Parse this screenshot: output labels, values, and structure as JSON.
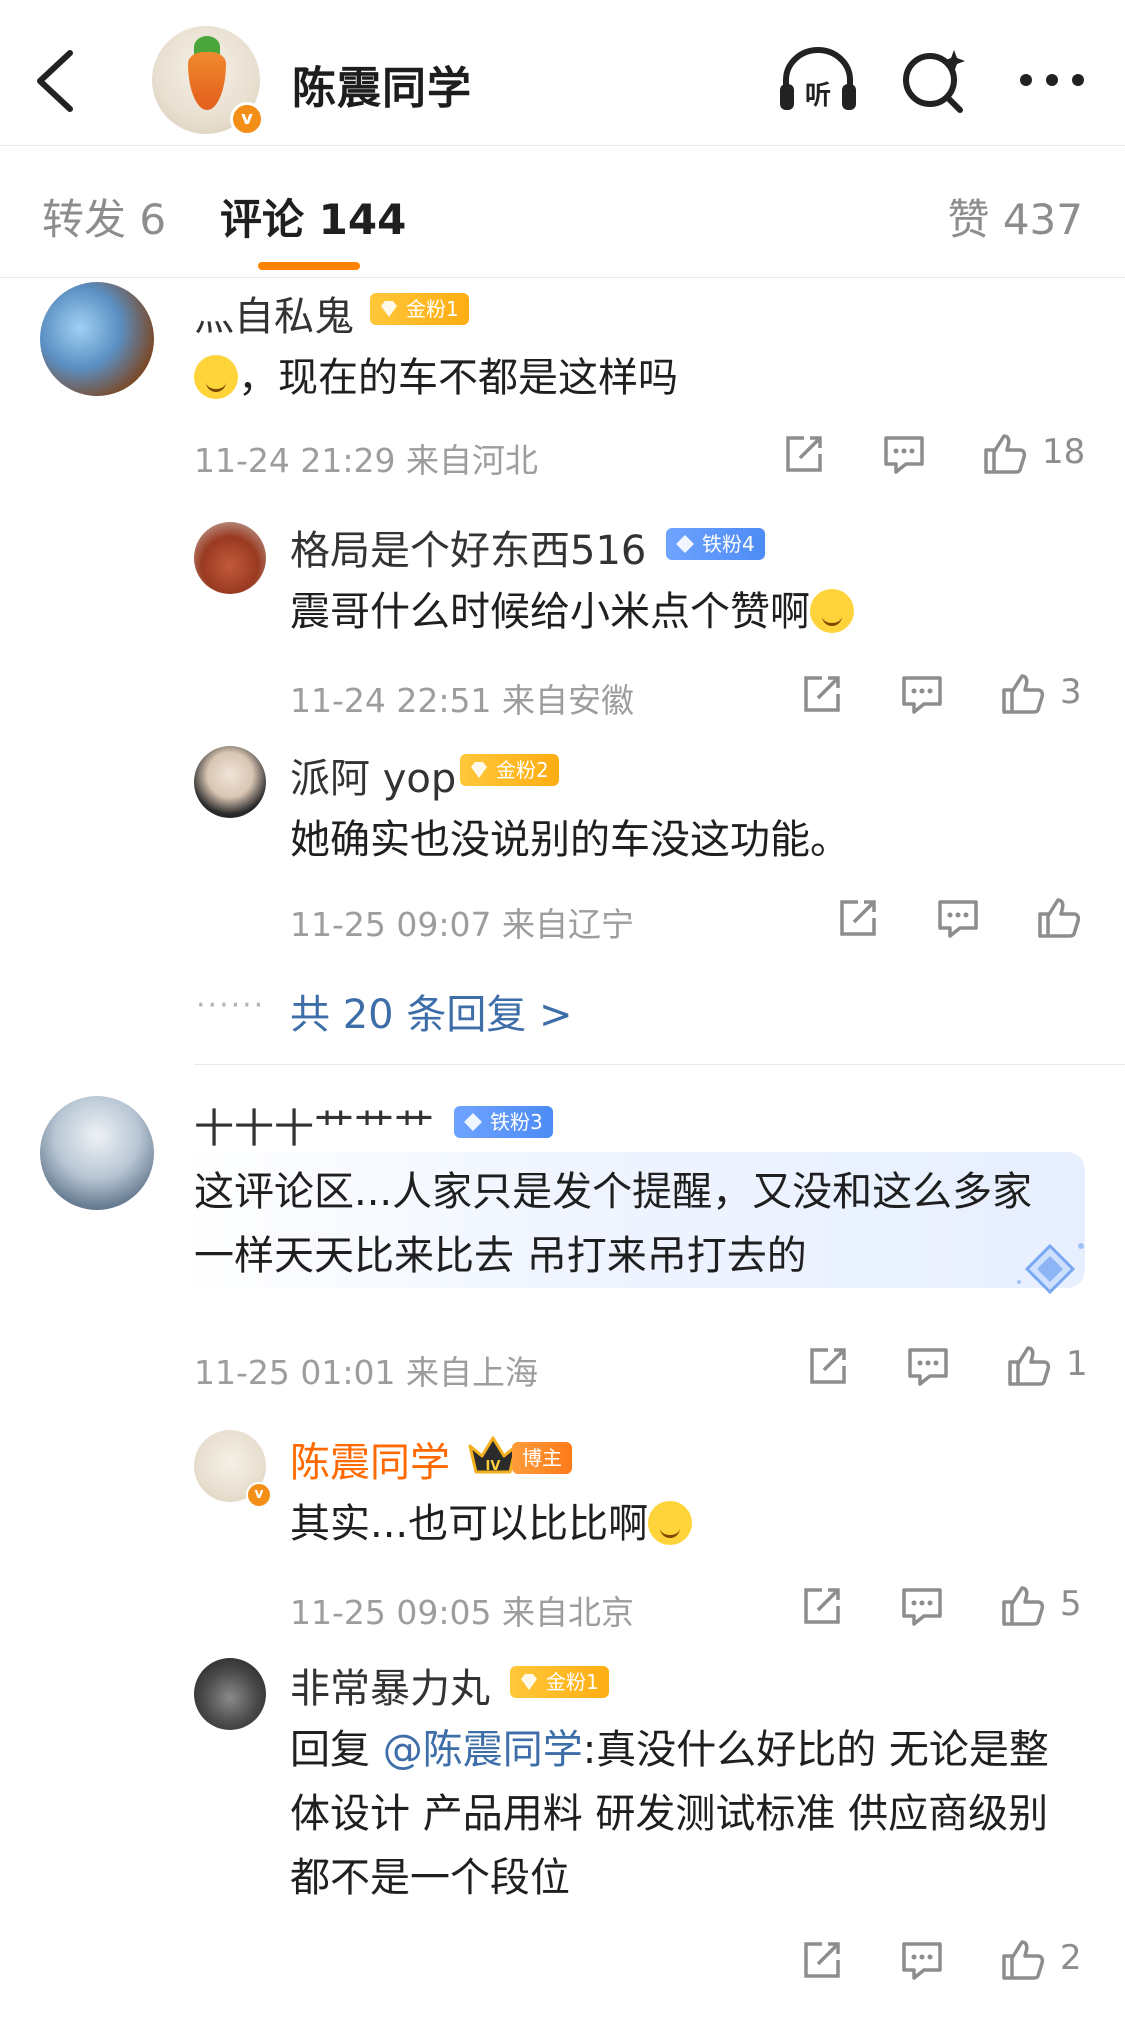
{
  "header": {
    "title": "陈震同学",
    "icons": [
      "back-icon",
      "listen-icon",
      "search-icon",
      "more-icon"
    ]
  },
  "tabs": {
    "repost": "转发 6",
    "comments": "评论 144",
    "likes": "赞 437"
  },
  "comments": [
    {
      "name": "灬自私鬼",
      "badge": "金粉1",
      "text": "，现在的车不都是这样吗",
      "meta": "11-24 21:29  来自河北",
      "likes": "18",
      "replies": [
        {
          "name": "格局是个好东西516",
          "badge": "铁粉4",
          "text": "震哥什么时候给小米点个赞啊",
          "meta": "11-24 22:51  来自安徽",
          "likes": "3"
        },
        {
          "name": "派阿 yop",
          "badge": "金粉2",
          "text": "她确实也没说别的车没这功能。",
          "meta": "11-25 09:07  来自辽宁",
          "likes": ""
        }
      ],
      "more_replies": "共 20 条回复 >"
    },
    {
      "name": "十十十艹艹艹",
      "badge": "铁粉3",
      "text_line1": "这评论区...人家只是发个提醒，又没和这么多家",
      "text_line2": "一样天天比来比去 吊打来吊打去的",
      "meta": "11-25 01:01  来自上海",
      "likes": "1",
      "replies": [
        {
          "name": "陈震同学",
          "badge": "博主",
          "text": "其实...也可以比比啊",
          "meta": "11-25 09:05  来自北京",
          "likes": "5"
        },
        {
          "name": "非常暴力丸",
          "badge": "金粉1",
          "prefix": "回复",
          "mention": "@陈震同学",
          "text_line1": ":真没什么好比的 无论是整",
          "text_line2": "体设计 产品用料 研发测试标准 供应商级别",
          "text_line3": "都不是一个段位",
          "likes": "2"
        }
      ]
    }
  ],
  "verified_mark": "v",
  "rank_mark": "IV",
  "colors": {
    "accent": "#ff8200",
    "link": "#3e6ea8",
    "meta": "#9d9d9d"
  }
}
